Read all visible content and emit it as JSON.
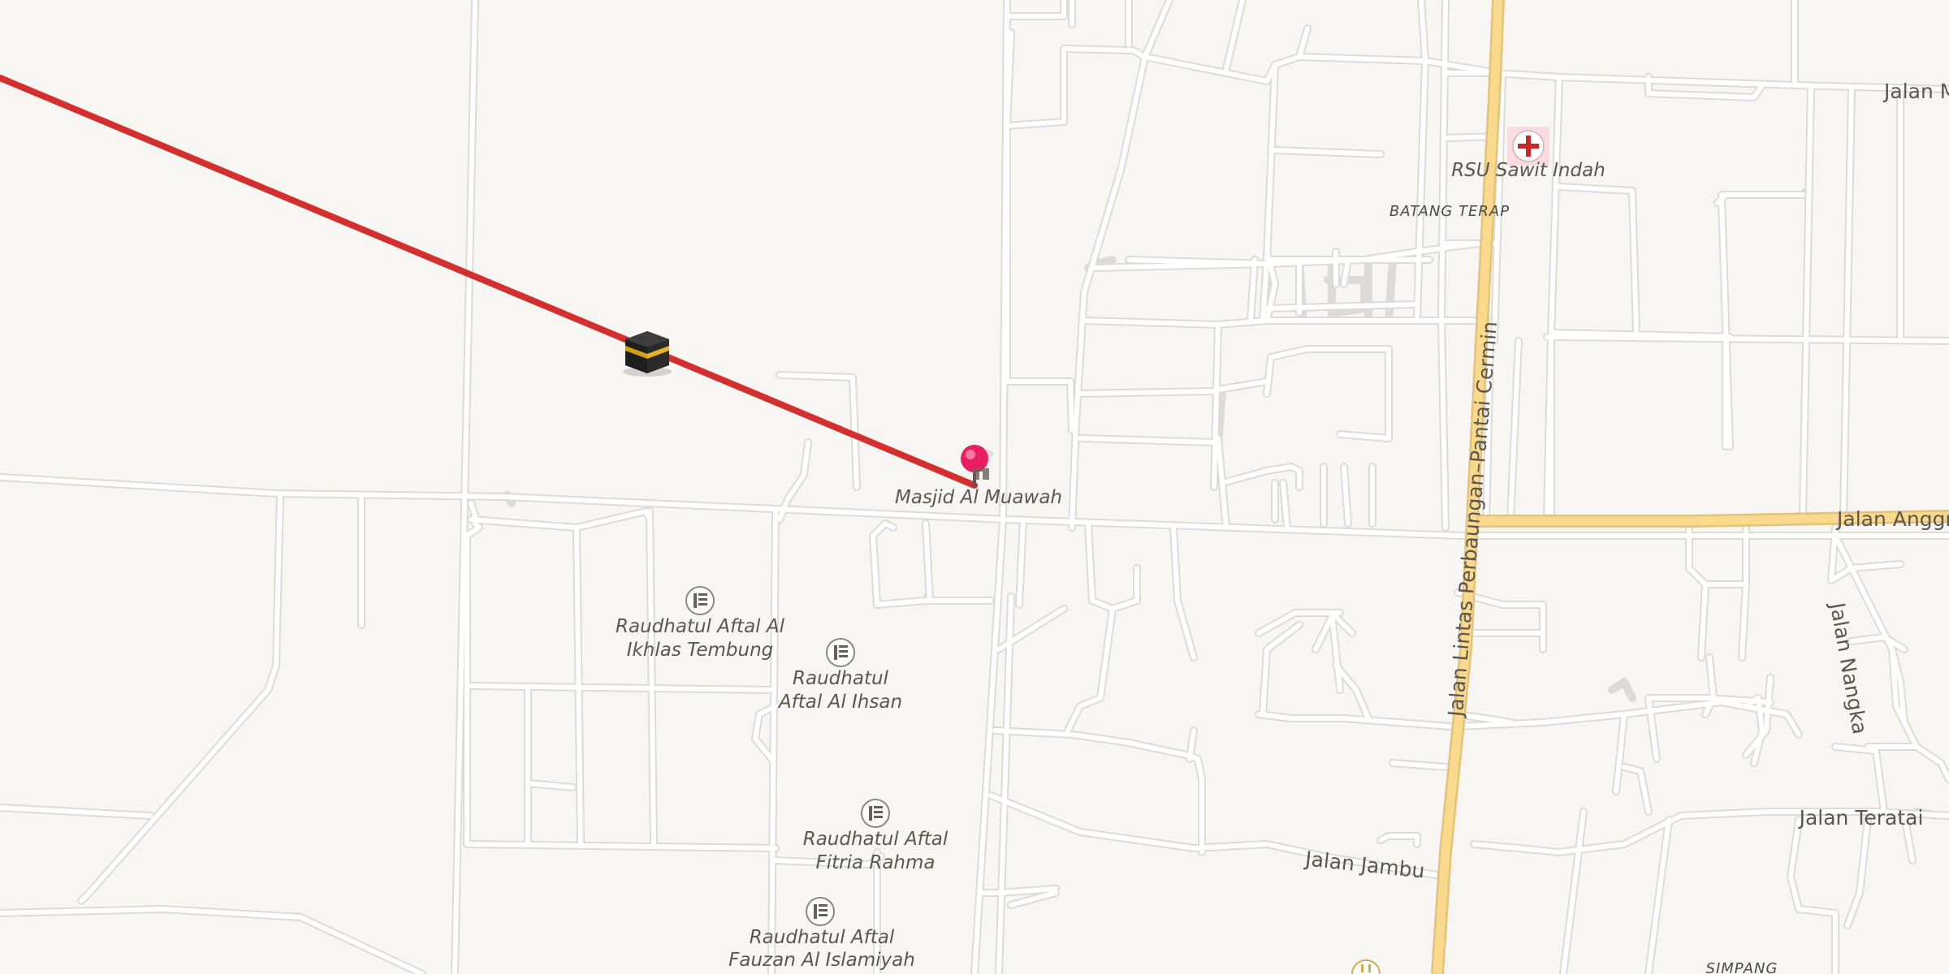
{
  "map": {
    "poi_labels": {
      "mosque": "Masjid Al Muawah",
      "hospital": "RSU Sawit Indah",
      "school1_line1": "Raudhatul Aftal Al",
      "school1_line2": "Ikhlas Tembung",
      "school2_line1": "Raudhatul",
      "school2_line2": "Aftal Al Ihsan",
      "school3_line1": "Raudhatul Aftal",
      "school3_line2": "Fitria Rahma",
      "school4_line1": "Raudhatul Aftal",
      "school4_line2": "Fauzan Al Islamiyah"
    },
    "area_labels": {
      "batang_terap": "BATANG TERAP",
      "simpang": "SIMPANG"
    },
    "road_labels": {
      "jalan_m": "Jalan M",
      "jalan_anggrek": "Jalan Anggre",
      "jalan_lintas": "Jalan Lintas Perbaungan–Pantai Cermin",
      "jalan_nangka": "Jalan Nangka",
      "jalan_teratai": "Jalan Teratai",
      "jalan_jambu": "Jalan Jambu"
    },
    "qibla_line_color": "#d32f2f",
    "major_road_color": "#f9d98c",
    "pin_color": "#e91e63",
    "icons": [
      "kaaba-icon",
      "location-pin-icon",
      "hospital-icon",
      "school-icon",
      "mosque-icon"
    ]
  }
}
